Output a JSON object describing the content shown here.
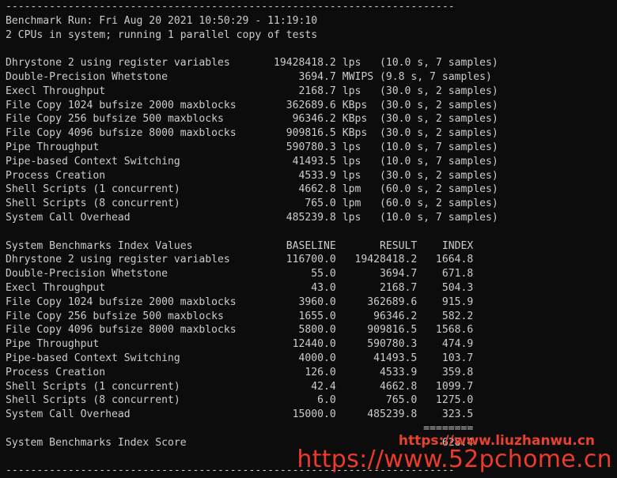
{
  "terminal": {
    "lines": [
      "------------------------------------------------------------------------",
      "Benchmark Run: Fri Aug 20 2021 10:50:29 - 11:19:10",
      "2 CPUs in system; running 1 parallel copy of tests",
      "",
      "Dhrystone 2 using register variables       19428418.2 lps   (10.0 s, 7 samples)",
      "Double-Precision Whetstone                     3694.7 MWIPS (9.8 s, 7 samples)",
      "Execl Throughput                               2168.7 lps   (30.0 s, 2 samples)",
      "File Copy 1024 bufsize 2000 maxblocks        362689.6 KBps  (30.0 s, 2 samples)",
      "File Copy 256 bufsize 500 maxblocks           96346.2 KBps  (30.0 s, 2 samples)",
      "File Copy 4096 bufsize 8000 maxblocks        909816.5 KBps  (30.0 s, 2 samples)",
      "Pipe Throughput                              590780.3 lps   (10.0 s, 7 samples)",
      "Pipe-based Context Switching                  41493.5 lps   (10.0 s, 7 samples)",
      "Process Creation                               4533.9 lps   (30.0 s, 2 samples)",
      "Shell Scripts (1 concurrent)                   4662.8 lpm   (60.0 s, 2 samples)",
      "Shell Scripts (8 concurrent)                    765.0 lpm   (60.0 s, 2 samples)",
      "System Call Overhead                         485239.8 lps   (10.0 s, 7 samples)",
      "",
      "System Benchmarks Index Values               BASELINE       RESULT    INDEX",
      "Dhrystone 2 using register variables         116700.0   19428418.2   1664.8",
      "Double-Precision Whetstone                       55.0       3694.7    671.8",
      "Execl Throughput                                 43.0       2168.7    504.3",
      "File Copy 1024 bufsize 2000 maxblocks          3960.0     362689.6    915.9",
      "File Copy 256 bufsize 500 maxblocks            1655.0      96346.2    582.2",
      "File Copy 4096 bufsize 8000 maxblocks          5800.0     909816.5   1568.6",
      "Pipe Throughput                               12440.0     590780.3    474.9",
      "Pipe-based Context Switching                   4000.0      41493.5    103.7",
      "Process Creation                                126.0       4533.9    359.8",
      "Shell Scripts (1 concurrent)                     42.4       4662.8   1099.7",
      "Shell Scripts (8 concurrent)                      6.0        765.0   1275.0",
      "System Call Overhead                          15000.0     485239.8    323.5",
      "                                                                   ========",
      "System Benchmarks Index Score                                         628.4",
      "",
      "------------------------------------------------------------------------"
    ]
  },
  "watermark": {
    "small": "https://www.liuzhanwu.cn",
    "big": "https://www.52pchome.cn"
  },
  "colors": {
    "background": "#0c0c0c",
    "text": "#cccccc",
    "watermark": "#ee3a2a"
  }
}
